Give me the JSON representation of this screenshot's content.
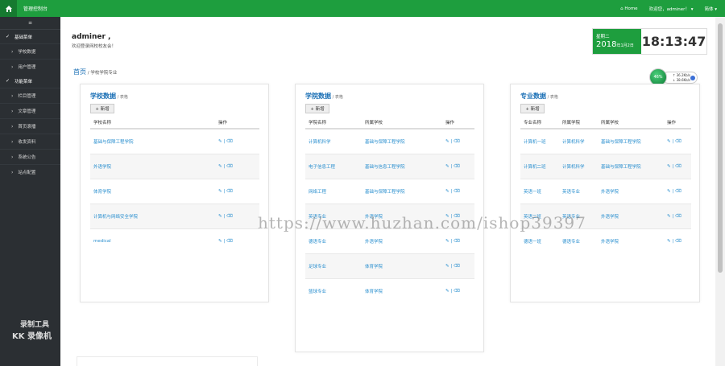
{
  "topbar": {
    "brand": "管理控制台",
    "home_link": "Home",
    "welcome": "欢迎您，adminer！",
    "lang": "简体"
  },
  "sidebar": {
    "toggle": "≡",
    "sections": [
      {
        "label": "基础菜单",
        "items": [
          "学校数据",
          "用户管理"
        ]
      },
      {
        "label": "功能菜单",
        "items": [
          "栏目管理",
          "文章管理",
          "首页滚播",
          "收发资料",
          "系统公告",
          "站点配置"
        ]
      }
    ]
  },
  "watermark": {
    "line1": "录制工具",
    "line2": "KK 录像机"
  },
  "header": {
    "user": "adminer ,",
    "subtitle": "欢迎登录网校校友会！"
  },
  "clock": {
    "weekday": "星期二",
    "year": "2018",
    "date": "年1月2日",
    "time": "18:13:47"
  },
  "netball": {
    "percent": "46%",
    "up": "↑ 36.2Kb/s",
    "down": "↓ 38.6Kb/s"
  },
  "breadcrumb": {
    "home": "首页",
    "path": " / 学校学院专业"
  },
  "panels": {
    "schools": {
      "title": "学校数据",
      "subtitle": " / 表格",
      "add": "+ 新增",
      "headers": [
        "学校名称",
        "操作"
      ],
      "rows": [
        [
          "基础与保障工程学院",
          "✎ | ⌫"
        ],
        [
          "外语学院",
          "✎ | ⌫"
        ],
        [
          "体育学院",
          "✎ | ⌫"
        ],
        [
          "计算机与网络安全学院",
          "✎ | ⌫"
        ],
        [
          "medical",
          "✎ | ⌫"
        ]
      ]
    },
    "colleges": {
      "title": "学院数据",
      "subtitle": " / 表格",
      "add": "+ 新增",
      "headers": [
        "学院名称",
        "所属学校",
        "操作"
      ],
      "rows": [
        [
          "计算机科学",
          "基础与保障工程学院",
          "✎ | ⌫"
        ],
        [
          "电子信息工程",
          "基础与信息工程学院",
          "✎ | ⌫"
        ],
        [
          "网络工程",
          "基础与保障工程学院",
          "✎ | ⌫"
        ],
        [
          "英语专业",
          "外语学院",
          "✎ | ⌫"
        ],
        [
          "德语专业",
          "外语学院",
          "✎ | ⌫"
        ],
        [
          "足球专业",
          "体育学院",
          "✎ | ⌫"
        ],
        [
          "篮球专业",
          "体育学院",
          "✎ | ⌫"
        ]
      ]
    },
    "majors": {
      "title": "专业数据",
      "subtitle": " / 表格",
      "add": "+ 新增",
      "headers": [
        "专业名称",
        "所属学院",
        "所属学校",
        "操作"
      ],
      "rows": [
        [
          "计算机一班",
          "计算机科学",
          "基础与保障工程学院",
          "✎ | ⌫"
        ],
        [
          "计算机二班",
          "计算机科学",
          "基础与保障工程学院",
          "✎ | ⌫"
        ],
        [
          "英语一班",
          "英语专业",
          "外语学院",
          "✎ | ⌫"
        ],
        [
          "英语二班",
          "英语专业",
          "外语学院",
          "✎ | ⌫"
        ],
        [
          "德语一班",
          "德语专业",
          "外语学院",
          "✎ | ⌫"
        ]
      ]
    }
  },
  "url_watermark": "https://www.huzhan.com/ishop39397"
}
